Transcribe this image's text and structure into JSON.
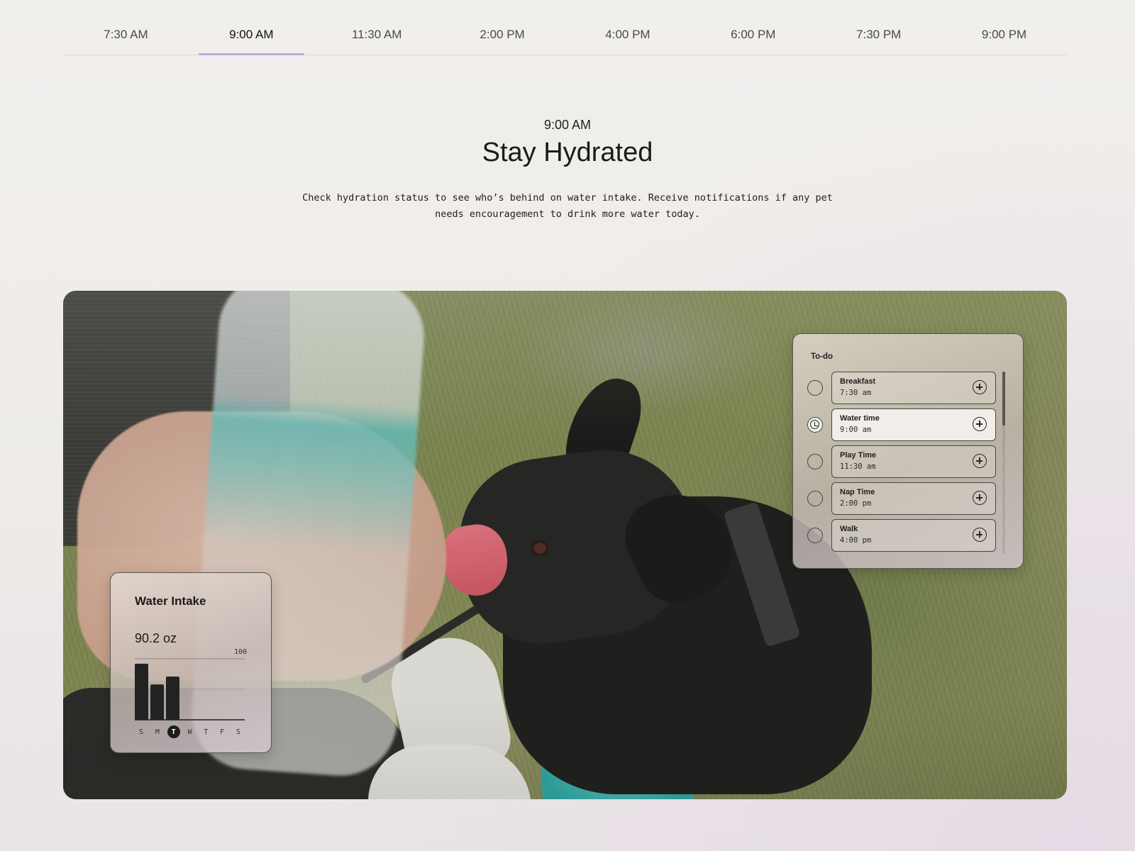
{
  "timeline": {
    "tabs": [
      {
        "label": "7:30 AM"
      },
      {
        "label": "9:00 AM"
      },
      {
        "label": "11:30 AM"
      },
      {
        "label": "2:00 PM"
      },
      {
        "label": "4:00 PM"
      },
      {
        "label": "6:00 PM"
      },
      {
        "label": "7:30 PM"
      },
      {
        "label": "9:00 PM"
      }
    ],
    "active_index": 1,
    "accent_color": "#c1a4de"
  },
  "section": {
    "time": "9:00 AM",
    "title": "Stay Hydrated",
    "description_line1": "Check hydration status to see who’s behind on water intake. Receive notifications if any pet",
    "description_line2": "needs encouragement to  drink more water today."
  },
  "water_widget": {
    "title": "Water Intake",
    "value": "90.2 oz",
    "max_label": "100",
    "days": [
      "S",
      "M",
      "T",
      "W",
      "T",
      "F",
      "S"
    ],
    "active_day_index": 2
  },
  "chart_data": {
    "type": "bar",
    "categories": [
      "S",
      "M",
      "T",
      "W",
      "T",
      "F",
      "S"
    ],
    "values": [
      92,
      58,
      71,
      0,
      0,
      0,
      0
    ],
    "ylim": [
      0,
      100
    ],
    "grid": true,
    "title": "",
    "xlabel": "",
    "ylabel": ""
  },
  "todo_widget": {
    "title": "To-do",
    "items": [
      {
        "name": "Breakfast",
        "time": "7:30 am",
        "status": "empty"
      },
      {
        "name": "Water time",
        "time": "9:00 am",
        "status": "in-progress"
      },
      {
        "name": "Play Time",
        "time": "11:30 am",
        "status": "empty"
      },
      {
        "name": "Nap Time",
        "time": "2:00 pm",
        "status": "empty"
      },
      {
        "name": "Walk",
        "time": "4:00 pm",
        "status": "empty"
      }
    ]
  }
}
